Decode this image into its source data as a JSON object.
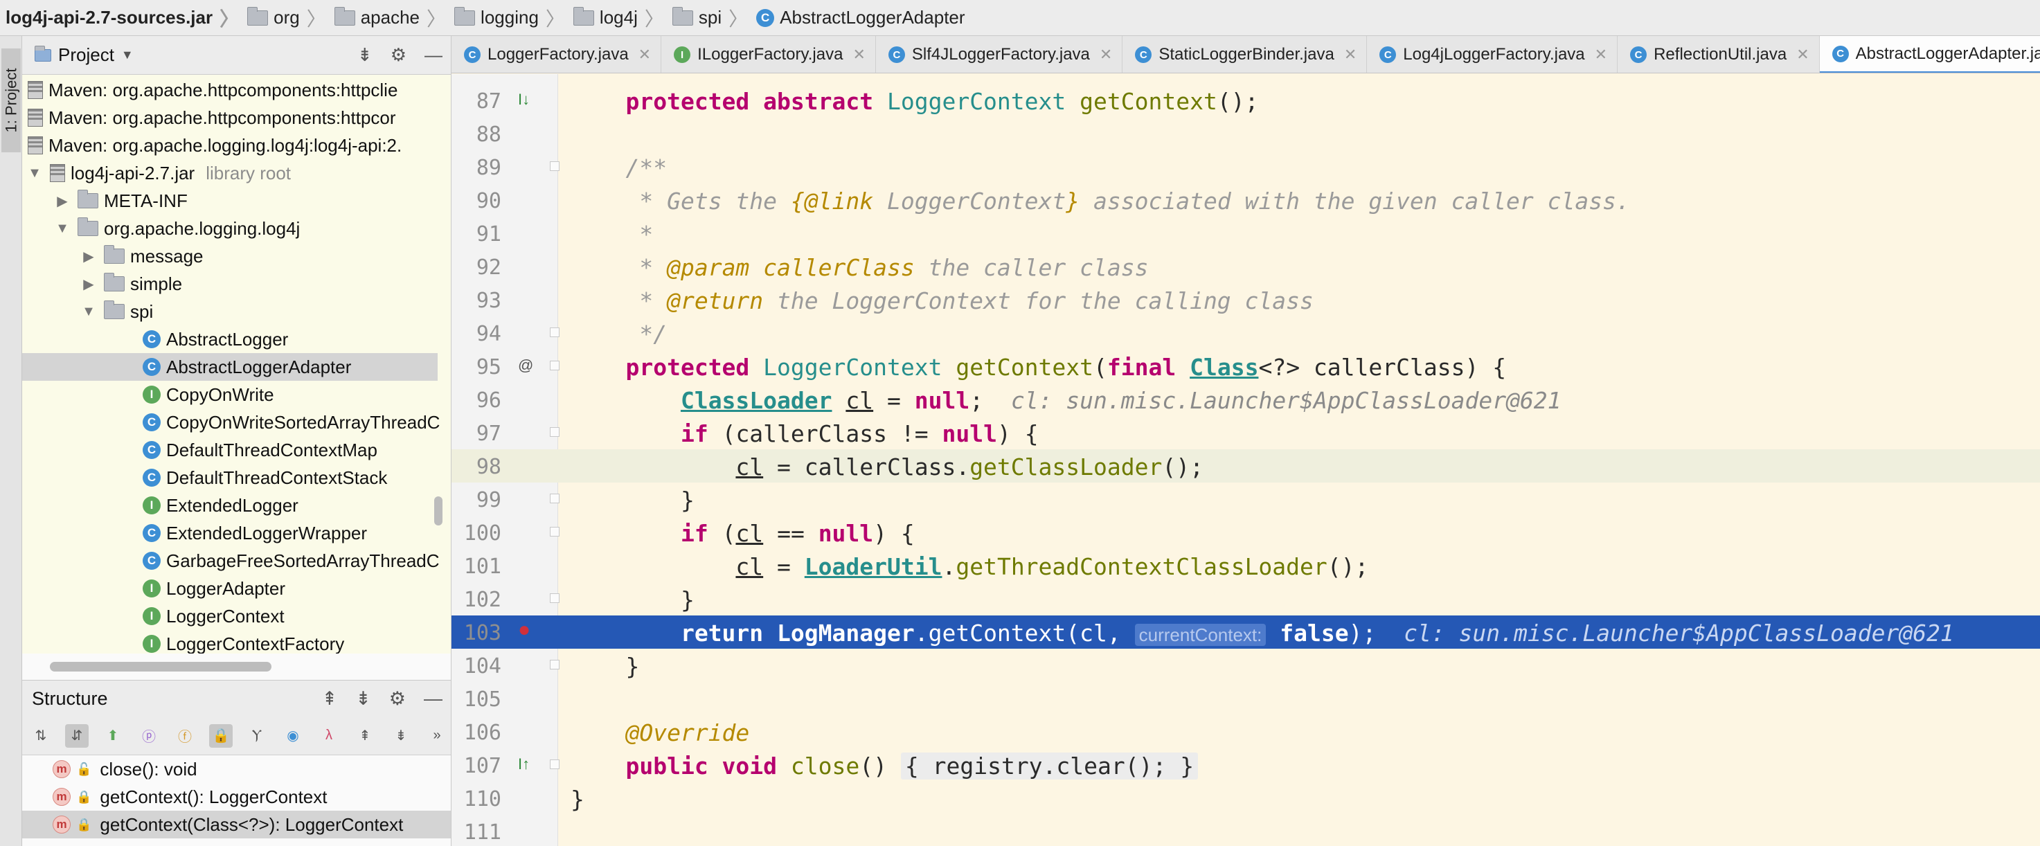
{
  "breadcrumbs": [
    {
      "label": "log4j-api-2.7-sources.jar",
      "icon": "jar-icon"
    },
    {
      "label": "org",
      "icon": "package-icon"
    },
    {
      "label": "apache",
      "icon": "package-icon"
    },
    {
      "label": "logging",
      "icon": "package-icon"
    },
    {
      "label": "log4j",
      "icon": "package-icon"
    },
    {
      "label": "spi",
      "icon": "package-icon"
    },
    {
      "label": "AbstractLoggerAdapter",
      "icon": "class-icon"
    }
  ],
  "stripe_label": "1: Project",
  "project": {
    "title": "Project",
    "tree": [
      {
        "label": "Maven: org.apache.httpcomponents:httpclie",
        "icon": "jar-icon",
        "depth": 0
      },
      {
        "label": "Maven: org.apache.httpcomponents:httpcor",
        "icon": "jar-icon",
        "depth": 0
      },
      {
        "label": "Maven: org.apache.logging.log4j:log4j-api:2.",
        "icon": "jar-icon",
        "depth": 0
      },
      {
        "label": "log4j-api-2.7.jar",
        "icon": "jar-icon",
        "depth": 0,
        "arrow": "▼",
        "suffix": "library root"
      },
      {
        "label": "META-INF",
        "icon": "folder-icon",
        "depth": 1,
        "arrow": "▶"
      },
      {
        "label": "org.apache.logging.log4j",
        "icon": "package-icon",
        "depth": 1,
        "arrow": "▼"
      },
      {
        "label": "message",
        "icon": "package-icon",
        "depth": 2,
        "arrow": "▶"
      },
      {
        "label": "simple",
        "icon": "package-icon",
        "depth": 2,
        "arrow": "▶"
      },
      {
        "label": "spi",
        "icon": "package-icon",
        "depth": 2,
        "arrow": "▼"
      },
      {
        "label": "AbstractLogger",
        "icon": "class-icon",
        "depth": 3
      },
      {
        "label": "AbstractLoggerAdapter",
        "icon": "class-icon",
        "depth": 3,
        "selected": true
      },
      {
        "label": "CopyOnWrite",
        "icon": "interface-icon",
        "depth": 3
      },
      {
        "label": "CopyOnWriteSortedArrayThreadC",
        "icon": "class-icon",
        "depth": 3
      },
      {
        "label": "DefaultThreadContextMap",
        "icon": "class-icon",
        "depth": 3
      },
      {
        "label": "DefaultThreadContextStack",
        "icon": "class-icon",
        "depth": 3
      },
      {
        "label": "ExtendedLogger",
        "icon": "interface-icon",
        "depth": 3
      },
      {
        "label": "ExtendedLoggerWrapper",
        "icon": "class-icon",
        "depth": 3
      },
      {
        "label": "GarbageFreeSortedArrayThreadC",
        "icon": "class-icon",
        "depth": 3
      },
      {
        "label": "LoggerAdapter",
        "icon": "interface-icon",
        "depth": 3
      },
      {
        "label": "LoggerContext",
        "icon": "interface-icon",
        "depth": 3
      },
      {
        "label": "LoggerContextFactory",
        "icon": "interface-icon",
        "depth": 3
      }
    ]
  },
  "structure": {
    "title": "Structure",
    "items": [
      {
        "label": "close(): void",
        "selected": false
      },
      {
        "label": "getContext(): LoggerContext",
        "selected": false
      },
      {
        "label": "getContext(Class<?>): LoggerContext",
        "selected": true
      }
    ]
  },
  "tabs": [
    {
      "label": "LoggerFactory.java",
      "icon": "class-icon",
      "active": false
    },
    {
      "label": "ILoggerFactory.java",
      "icon": "interface-icon",
      "active": false
    },
    {
      "label": "Slf4JLoggerFactory.java",
      "icon": "class-icon",
      "active": false
    },
    {
      "label": "StaticLoggerBinder.java",
      "icon": "class-icon",
      "active": false
    },
    {
      "label": "Log4jLoggerFactory.java",
      "icon": "class-icon",
      "active": false
    },
    {
      "label": "ReflectionUtil.java",
      "icon": "class-icon",
      "active": false
    },
    {
      "label": "AbstractLoggerAdapter.java",
      "icon": "class-icon",
      "active": true
    }
  ],
  "editor": {
    "lines": [
      {
        "n": "87",
        "gutter": "implements-up-icon"
      },
      {
        "n": "88"
      },
      {
        "n": "89"
      },
      {
        "n": "90"
      },
      {
        "n": "91"
      },
      {
        "n": "92"
      },
      {
        "n": "93"
      },
      {
        "n": "94"
      },
      {
        "n": "95",
        "gutter": "at-icon"
      },
      {
        "n": "96"
      },
      {
        "n": "97"
      },
      {
        "n": "98",
        "state": "cur"
      },
      {
        "n": "99"
      },
      {
        "n": "100"
      },
      {
        "n": "101"
      },
      {
        "n": "102"
      },
      {
        "n": "103",
        "gutter": "breakpoint-icon",
        "state": "exec"
      },
      {
        "n": "104"
      },
      {
        "n": "105"
      },
      {
        "n": "106"
      },
      {
        "n": "107",
        "gutter": "override-up-icon"
      },
      {
        "n": "110"
      },
      {
        "n": "111"
      }
    ],
    "code": {
      "l87": {
        "kw1": "protected abstract",
        "ty": "LoggerContext",
        "fn": "getContext",
        "rest": "();"
      },
      "l89": "/**",
      "l90": {
        "pre": " * Gets the ",
        "tag": "{@link ",
        "ty": "LoggerContext",
        "tagEnd": "}",
        "rest": " associated with the given caller class."
      },
      "l91": " *",
      "l92": {
        "pre": " * ",
        "tag": "@param ",
        "param": "callerClass",
        "rest": " the caller class"
      },
      "l93": {
        "pre": " * ",
        "tag": "@return",
        "rest": " the LoggerContext for the calling class"
      },
      "l94": " */",
      "l95": {
        "kw": "protected",
        "ty": "LoggerContext",
        "fn": "getContext",
        "p1": "(",
        "kw2": "final",
        "ty2": "Class",
        "gen": "<?> callerClass) {"
      },
      "l96": {
        "ty": "ClassLoader",
        "var": "cl",
        "eq": " = ",
        "kw": "null",
        "semi": ";",
        "hint": "  cl: sun.misc.Launcher$AppClassLoader@621"
      },
      "l97": {
        "kw": "if",
        "p": " (callerClass != ",
        "kw2": "null",
        "rest": ") {"
      },
      "l98": {
        "var": "cl",
        "rest": " = callerClass.",
        "fn": "getClassLoader",
        "end": "();"
      },
      "l99": "}",
      "l100": {
        "kw": "if",
        "p": " (",
        "var": "cl",
        "mid": " == ",
        "kw2": "null",
        "rest": ") {"
      },
      "l101": {
        "var": "cl",
        "eq": " = ",
        "ty": "LoaderUtil",
        "dot": ".",
        "fn": "getThreadContextClassLoader",
        "end": "();"
      },
      "l102": "}",
      "l103": {
        "kw": "return",
        "cls": " LogManager",
        "dot": ".",
        "fn": "getContext",
        "p": "(cl, ",
        "chip": "currentContext:",
        "kw2": " false",
        "end": ");",
        "hint": "  cl: sun.misc.Launcher$AppClassLoader@621"
      },
      "l104": "}",
      "l106": "@Override",
      "l107": {
        "kw": "public void",
        "fn": "close",
        "p": "()",
        "body": "{ registry.clear(); }"
      },
      "l110": "}"
    }
  }
}
